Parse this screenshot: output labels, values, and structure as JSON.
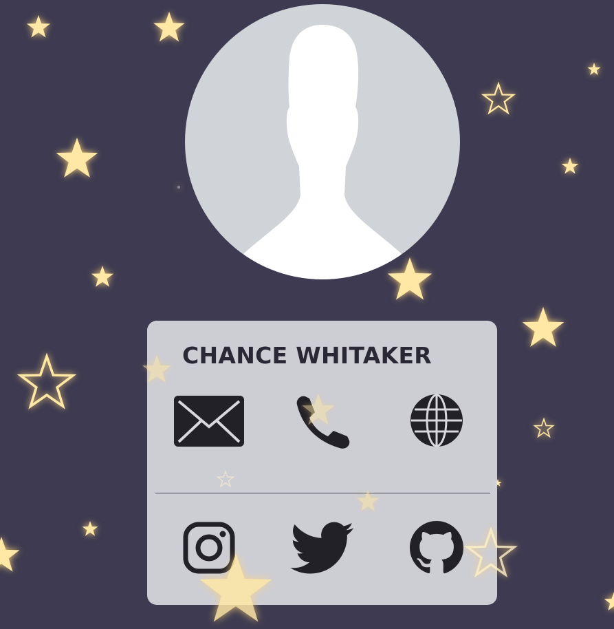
{
  "profile": {
    "name": "CHANCE WHITAKER"
  },
  "contact_icons": [
    "envelope-icon",
    "phone-icon",
    "globe-icon"
  ],
  "social_icons": [
    "instagram-icon",
    "twitter-icon",
    "github-icon"
  ],
  "colors": {
    "background": "#3d3a51",
    "star": "#ffe7a6",
    "star_glow": "#ffd678",
    "card": "#d8d8de",
    "icon": "#232128",
    "avatar_bg": "#d0d3d8",
    "avatar_silhouette": "#ffffff"
  }
}
